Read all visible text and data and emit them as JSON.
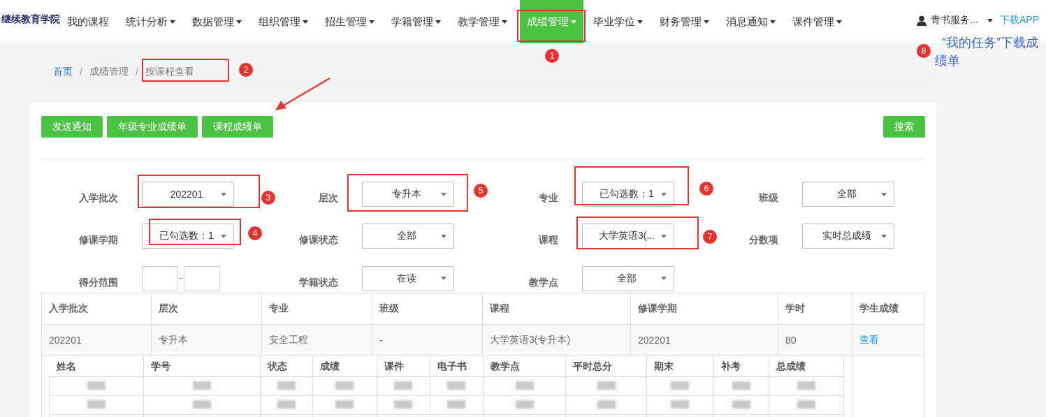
{
  "nav": {
    "logo": "继续教育学院",
    "items": [
      {
        "label": "我的课程",
        "dropdown": false,
        "selected": false
      },
      {
        "label": "统计分析",
        "dropdown": true,
        "selected": false
      },
      {
        "label": "数据管理",
        "dropdown": true,
        "selected": false
      },
      {
        "label": "组织管理",
        "dropdown": true,
        "selected": false
      },
      {
        "label": "招生管理",
        "dropdown": true,
        "selected": false
      },
      {
        "label": "学籍管理",
        "dropdown": true,
        "selected": false
      },
      {
        "label": "教学管理",
        "dropdown": true,
        "selected": false
      },
      {
        "label": "成绩管理",
        "dropdown": true,
        "selected": true
      },
      {
        "label": "毕业学位",
        "dropdown": true,
        "selected": false
      },
      {
        "label": "财务管理",
        "dropdown": true,
        "selected": false
      },
      {
        "label": "消息通知",
        "dropdown": true,
        "selected": false
      },
      {
        "label": "课件管理",
        "dropdown": true,
        "selected": false
      }
    ],
    "user": "青书服务...",
    "download": "下载APP"
  },
  "breadcrumb": [
    "首页",
    "成绩管理",
    "按课程查看"
  ],
  "breadcrumb_separator": "/",
  "toolbar": {
    "buttons": [
      "发送通知",
      "年级专业成绩单",
      "课程成绩单"
    ],
    "search": "搜索"
  },
  "filters": [
    {
      "label": "入学批次",
      "kind": "select",
      "value": "202201"
    },
    {
      "label": "层次",
      "kind": "select",
      "value": "专升本"
    },
    {
      "label": "专业",
      "kind": "select",
      "value": "已勾选数：1"
    },
    {
      "label": "班级",
      "kind": "select",
      "value": "全部"
    },
    {
      "label": "修课学期",
      "kind": "select",
      "value": "已勾选数：1"
    },
    {
      "label": "修课状态",
      "kind": "select",
      "value": "全部"
    },
    {
      "label": "课程",
      "kind": "select",
      "value": "大学英语3(..."
    },
    {
      "label": "分数项",
      "kind": "select",
      "value": "实时总成绩"
    },
    {
      "label": "得分范围",
      "kind": "range"
    },
    {
      "label": "学籍状态",
      "kind": "select",
      "value": "在读"
    },
    {
      "label": "教学点",
      "kind": "select",
      "value": "全部"
    }
  ],
  "table": {
    "columns": [
      "入学批次",
      "层次",
      "专业",
      "班级",
      "课程",
      "修课学期",
      "学时",
      "学生成绩"
    ],
    "rows": [
      [
        "202201",
        "专升本",
        "安全工程",
        "-",
        "大学英语3(专升本)",
        "202201",
        "80",
        "查看"
      ]
    ]
  },
  "scores": {
    "columns": [
      "姓名",
      "学号",
      "状态",
      "成绩",
      "课件",
      "电子书",
      "教学点",
      "平时总分",
      "期末",
      "补考",
      "总成绩"
    ],
    "rows": [
      {
        "kind": "redacted"
      },
      {
        "kind": "redacted"
      }
    ]
  },
  "annotations": [
    {
      "number": "1"
    },
    {
      "number": "2"
    },
    {
      "number": "3"
    },
    {
      "number": "4"
    },
    {
      "number": "5"
    },
    {
      "number": "6"
    },
    {
      "number": "7"
    },
    {
      "number": "8",
      "note": "“我的任务”下载成绩单"
    }
  ]
}
